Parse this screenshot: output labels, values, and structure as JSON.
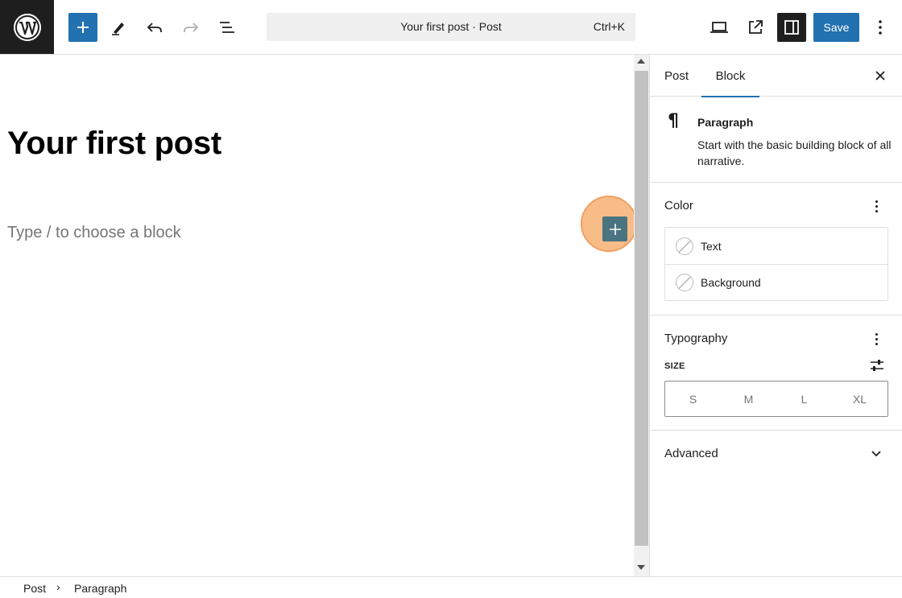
{
  "header": {
    "command_bar": {
      "title": "Your first post · Post",
      "shortcut": "Ctrl+K"
    },
    "save_label": "Save",
    "icons": [
      "wordpress-logo",
      "plus-icon",
      "pencil-icon",
      "undo-icon",
      "redo-icon",
      "list-view-icon",
      "desktop-preview-icon",
      "external-link-icon",
      "sidebar-icon",
      "more-vertical-icon"
    ]
  },
  "editor": {
    "title": "Your first post",
    "placeholder": "Type / to choose a block"
  },
  "sidebar": {
    "tabs": [
      {
        "label": "Post"
      },
      {
        "label": "Block"
      }
    ],
    "active_tab": "Block",
    "block": {
      "name": "Paragraph",
      "icon": "¶",
      "description": "Start with the basic building block of all narrative."
    },
    "color": {
      "title": "Color",
      "items": [
        {
          "label": "Text"
        },
        {
          "label": "Background"
        }
      ]
    },
    "typography": {
      "title": "Typography",
      "size_label": "SIZE",
      "sizes": [
        "S",
        "M",
        "L",
        "XL"
      ]
    },
    "advanced": {
      "title": "Advanced"
    }
  },
  "footer": {
    "breadcrumbs": [
      "Post",
      "Paragraph"
    ],
    "separator": "›"
  },
  "colors": {
    "accent": "#2271b1",
    "dark": "#1e1e1e",
    "highlight": "#f5a662",
    "add_block": "#4a7480"
  }
}
